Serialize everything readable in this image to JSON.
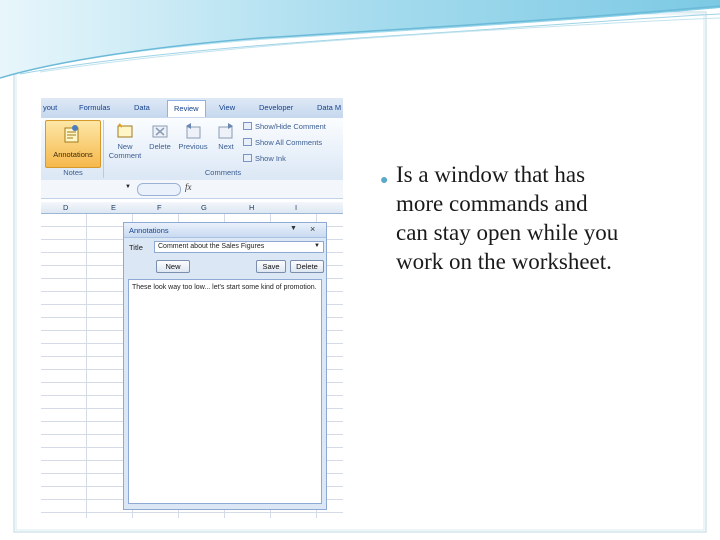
{
  "slide": {
    "lines": [
      "Is a window that has",
      "more commands and",
      "can stay open while you",
      "work on the worksheet."
    ]
  },
  "ribbon": {
    "tabs": [
      "yout",
      "Formulas",
      "Data",
      "Review",
      "View",
      "Developer",
      "Data M"
    ],
    "active_tab": "Review",
    "annotations_button": "Annotations",
    "notes_group": "Notes",
    "new_comment": [
      "New",
      "Comment"
    ],
    "delete": "Delete",
    "previous": "Previous",
    "next": "Next",
    "show_hide_comment": "Show/Hide Comment",
    "show_all_comments": "Show All Comments",
    "show_ink": "Show Ink",
    "comments_group": "Comments"
  },
  "formula_bar": {
    "fx": "fx"
  },
  "columns": [
    "D",
    "E",
    "F",
    "G",
    "H",
    "I"
  ],
  "pane": {
    "title": "Annotations",
    "title_label": "Title",
    "title_value": "Comment about the Sales Figures",
    "new_button": "New",
    "save_button": "Save",
    "delete_button": "Delete",
    "note_text": "These look way too low... let's start some kind of promotion."
  },
  "colors": {
    "accent": "#5aa9c9",
    "ribbon_text": "#15428b"
  }
}
